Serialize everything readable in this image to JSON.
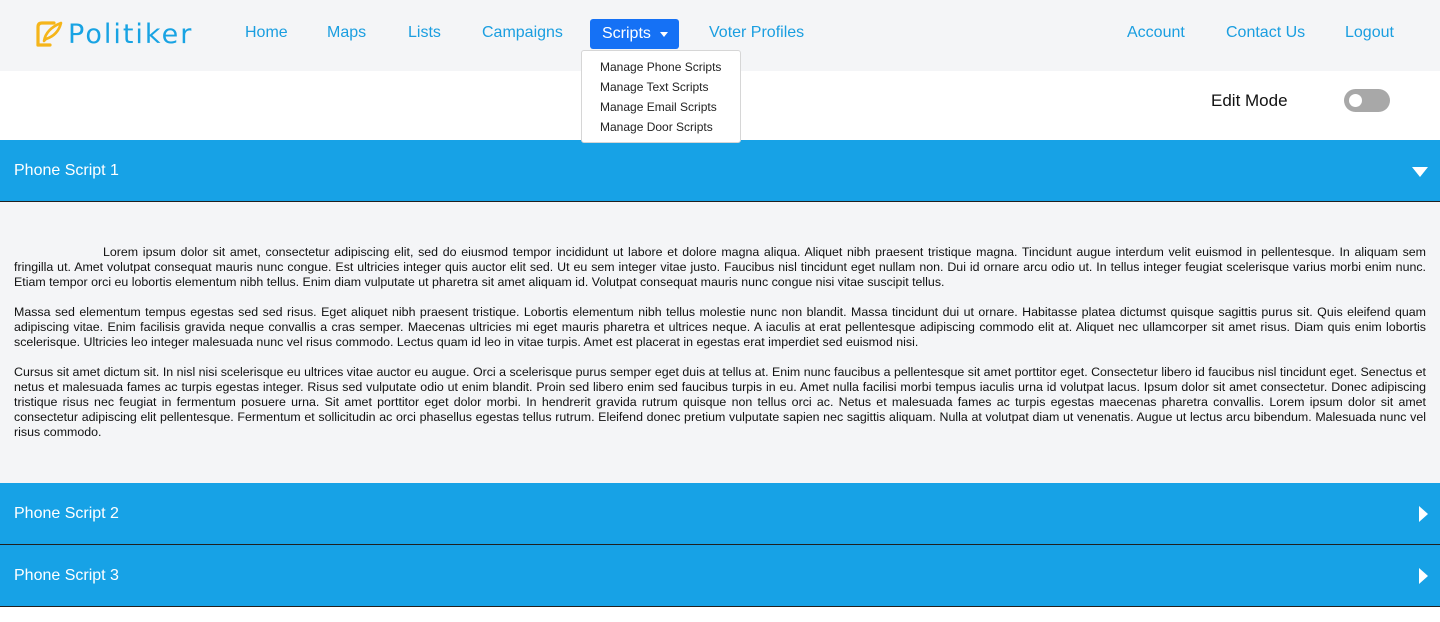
{
  "brand": {
    "name": "Politiker"
  },
  "nav": {
    "left": [
      "Home",
      "Maps",
      "Lists",
      "Campaigns"
    ],
    "active": "Scripts",
    "after": [
      "Voter Profiles"
    ],
    "right": [
      "Account",
      "Contact Us",
      "Logout"
    ]
  },
  "dropdown": {
    "items": [
      "Manage Phone Scripts",
      "Manage Text Scripts",
      "Manage Email Scripts",
      "Manage Door Scripts"
    ]
  },
  "edit_mode": {
    "label": "Edit Mode",
    "enabled": false
  },
  "panels": [
    {
      "title": "Phone Script 1",
      "expanded": true
    },
    {
      "title": "Phone Script 2",
      "expanded": false
    },
    {
      "title": "Phone Script 3",
      "expanded": false
    }
  ],
  "script_body": {
    "paragraphs": [
      "Lorem ipsum dolor sit amet, consectetur adipiscing elit, sed do eiusmod tempor incididunt ut labore et dolore magna aliqua. Aliquet nibh praesent tristique magna. Tincidunt augue interdum velit euismod in pellentesque. In aliquam sem fringilla ut. Amet volutpat consequat mauris nunc congue. Est ultricies integer quis auctor elit sed. Ut eu sem integer vitae justo. Faucibus nisl tincidunt eget nullam non. Dui id ornare arcu odio ut. In tellus integer feugiat scelerisque varius morbi enim nunc. Etiam tempor orci eu lobortis elementum nibh tellus. Enim diam vulputate ut pharetra sit amet aliquam id. Volutpat consequat mauris nunc congue nisi vitae suscipit tellus.",
      "Massa sed elementum tempus egestas sed sed risus. Eget aliquet nibh praesent tristique. Lobortis elementum nibh tellus molestie nunc non blandit. Massa tincidunt dui ut ornare. Habitasse platea dictumst quisque sagittis purus sit. Quis eleifend quam adipiscing vitae. Enim facilisis gravida neque convallis a cras semper. Maecenas ultricies mi eget mauris pharetra et ultrices neque. A iaculis at erat pellentesque adipiscing commodo elit at. Aliquet nec ullamcorper sit amet risus. Diam quis enim lobortis scelerisque. Ultricies leo integer malesuada nunc vel risus commodo. Lectus quam id leo in vitae turpis. Amet est placerat in egestas erat imperdiet sed euismod nisi.",
      "Cursus sit amet dictum sit. In nisl nisi scelerisque eu ultrices vitae auctor eu augue. Orci a scelerisque purus semper eget duis at tellus at. Enim nunc faucibus a pellentesque sit amet porttitor eget. Consectetur libero id faucibus nisl tincidunt eget. Senectus et netus et malesuada fames ac turpis egestas integer. Risus sed vulputate odio ut enim blandit. Proin sed libero enim sed faucibus turpis in eu. Amet nulla facilisi morbi tempus iaculis urna id volutpat lacus. Ipsum dolor sit amet consectetur. Donec adipiscing tristique risus nec feugiat in fermentum posuere urna. Sit amet porttitor eget dolor morbi. In hendrerit gravida rutrum quisque non tellus orci ac. Netus et malesuada fames ac turpis egestas maecenas pharetra convallis. Lorem ipsum dolor sit amet consectetur adipiscing elit pellentesque. Fermentum et sollicitudin ac orci phasellus egestas tellus rutrum. Eleifend donec pretium vulputate sapien nec sagittis aliquam. Nulla at volutpat diam ut venenatis. Augue ut lectus arcu bibendum. Malesuada nunc vel risus commodo."
    ]
  },
  "colors": {
    "brand_blue": "#18a3e3",
    "active_nav": "#1571f5",
    "panel_header": "#17a2e6",
    "nav_bg": "#f4f5f7"
  }
}
